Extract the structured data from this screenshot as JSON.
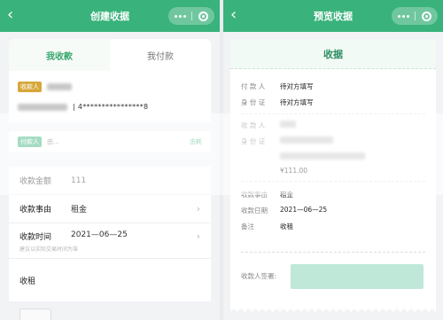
{
  "left": {
    "title": "创建收据",
    "tabs": [
      "我收款",
      "我付款"
    ],
    "payee_tag": "收款人",
    "account": "| 4****************8",
    "payer_tag": "付款人",
    "payer_hint": "由...",
    "payer_link": "由耗",
    "form": [
      {
        "label": "收款金额",
        "value": "111"
      },
      {
        "label": "收款事由",
        "value": "租金"
      },
      {
        "label": "收款时间",
        "value": "2021—06—25",
        "hint": "建议以实际交易时间为准"
      }
    ],
    "note": "收租"
  },
  "right": {
    "title": "预览收据",
    "heading": "收据",
    "payer_rows": [
      {
        "k": "付 款 人",
        "v": "待对方填写"
      },
      {
        "k": "身 份 证",
        "v": "待对方填写"
      }
    ],
    "payee_rows": [
      {
        "k": "收 款 人",
        "v": ""
      },
      {
        "k": "身 份 证",
        "v": ""
      },
      {
        "k": "",
        "v": "¥111.00"
      }
    ],
    "detail_rows": [
      {
        "k": "收款事由",
        "v": "租金"
      },
      {
        "k": "收款日期",
        "v": "2021—06—25"
      },
      {
        "k": "备注",
        "v": "收租"
      }
    ],
    "sign_label": "收款人签署:"
  },
  "colors": {
    "brand": "#39b27b",
    "accent_gold": "#d6a73b"
  }
}
